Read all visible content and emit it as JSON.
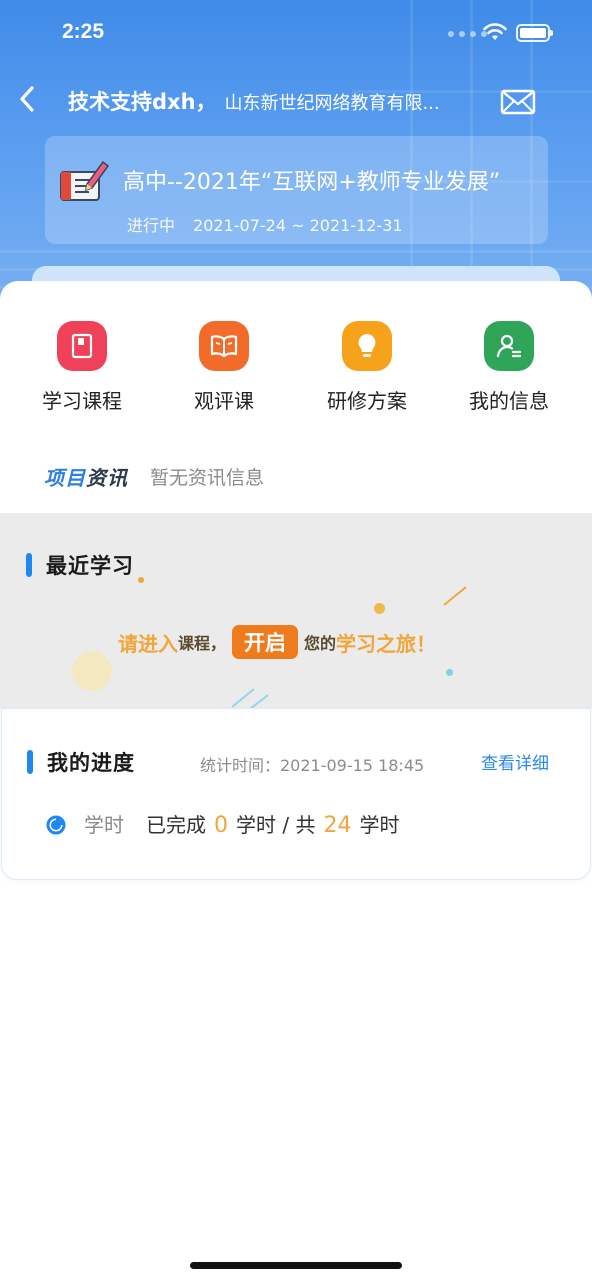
{
  "status_bar": {
    "time": "2:25"
  },
  "header": {
    "user": "技术支持dxh，",
    "organization": "山东新世纪网络教育有限...",
    "project": {
      "title": "高中--2021年“互联网+教师专业发展”",
      "status": "进行中",
      "date_range": "2021-07-24 ~ 2021-12-31"
    }
  },
  "quick_menu": [
    {
      "label": "学习课程",
      "icon": "book-icon",
      "color": "#f0415a"
    },
    {
      "label": "观评课",
      "icon": "open-book-icon",
      "color": "#f26b2a"
    },
    {
      "label": "研修方案",
      "icon": "lightbulb-icon",
      "color": "#f7a21b"
    },
    {
      "label": "我的信息",
      "icon": "user-info-icon",
      "color": "#2fa55a"
    }
  ],
  "news": {
    "logo_part1": "项目",
    "logo_part2": "资讯",
    "empty_text": "暂无资讯信息"
  },
  "recent_study": {
    "title": "最近学习",
    "banner": {
      "part1": "请进入",
      "part2": "课程，",
      "highlight": "开启",
      "part3": "您的",
      "part4": "学习之旅！"
    }
  },
  "progress": {
    "title": "我的进度",
    "stat_time": "统计时间：2021-09-15 18:45",
    "view_detail": "查看详细",
    "hours_label": "学时",
    "completed_prefix": "已完成",
    "completed_value": "0",
    "completed_unit": "学时 / 共",
    "total_value": "24",
    "total_unit": "学时"
  },
  "colors": {
    "accent": "#1e88f0",
    "orange": "#f0a63a",
    "link": "#2a8ae6"
  }
}
